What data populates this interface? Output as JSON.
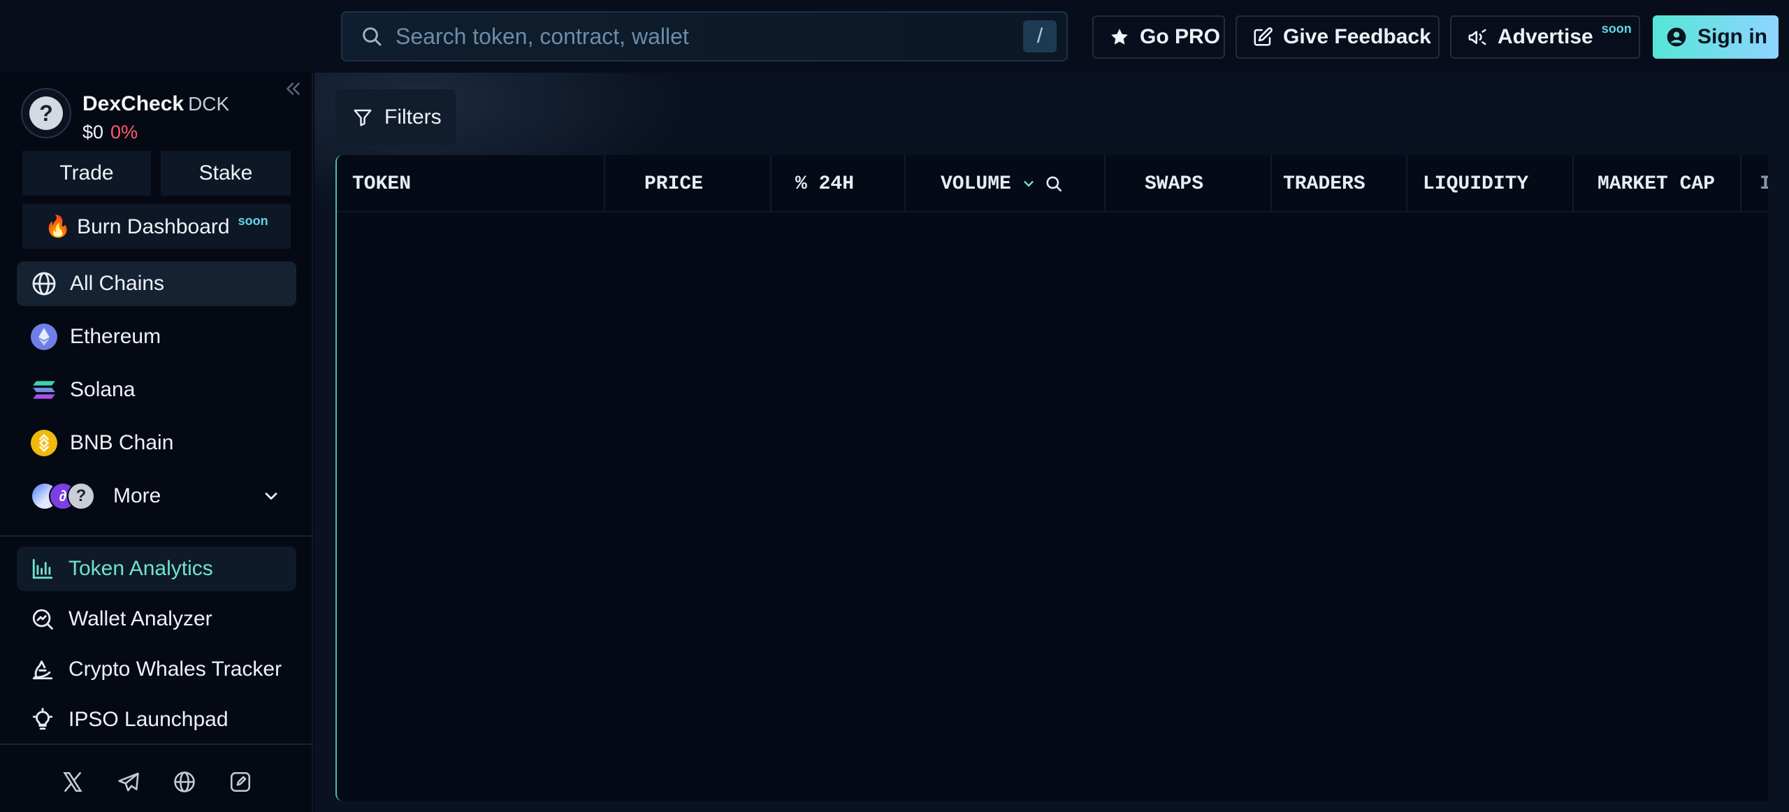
{
  "header": {
    "search_placeholder": "Search token, contract, wallet",
    "search_shortcut": "/",
    "go_pro": "Go PRO",
    "feedback": "Give Feedback",
    "advertise": "Advertise",
    "advertise_badge": "soon",
    "sign_in": "Sign in"
  },
  "sidebar": {
    "token": {
      "name": "DexCheck",
      "symbol": "DCK",
      "price": "$0",
      "change": "0%",
      "logo_glyph": "?"
    },
    "trade": "Trade",
    "stake": "Stake",
    "burn": {
      "label": "🔥 Burn Dashboard",
      "badge": "soon"
    },
    "chains": [
      {
        "label": "All Chains",
        "icon": "globe-icon"
      },
      {
        "label": "Ethereum",
        "icon": "ethereum-icon"
      },
      {
        "label": "Solana",
        "icon": "solana-icon"
      },
      {
        "label": "BNB Chain",
        "icon": "bnb-icon"
      },
      {
        "label": "More",
        "icon": "chevron-down-icon"
      }
    ],
    "nav": [
      {
        "label": "Token Analytics",
        "icon": "chart-bars-icon"
      },
      {
        "label": "Wallet Analyzer",
        "icon": "magnifier-chart-icon"
      },
      {
        "label": "Crypto Whales Tracker",
        "icon": "whale-icon"
      },
      {
        "label": "IPSO Launchpad",
        "icon": "lightbulb-icon"
      }
    ],
    "socials": [
      "x-icon",
      "telegram-icon",
      "globe-icon",
      "edit-icon"
    ]
  },
  "main": {
    "filters": "Filters",
    "columns": [
      "TOKEN",
      "PRICE",
      "% 24H",
      "VOLUME",
      "SWAPS",
      "TRADERS",
      "LIQUIDITY",
      "MARKET CAP",
      "I"
    ]
  },
  "colors": {
    "accent": "#6fe3d2",
    "negative": "#ff5c6c",
    "soon_badge": "#63d6e8",
    "background": "#060b16"
  }
}
